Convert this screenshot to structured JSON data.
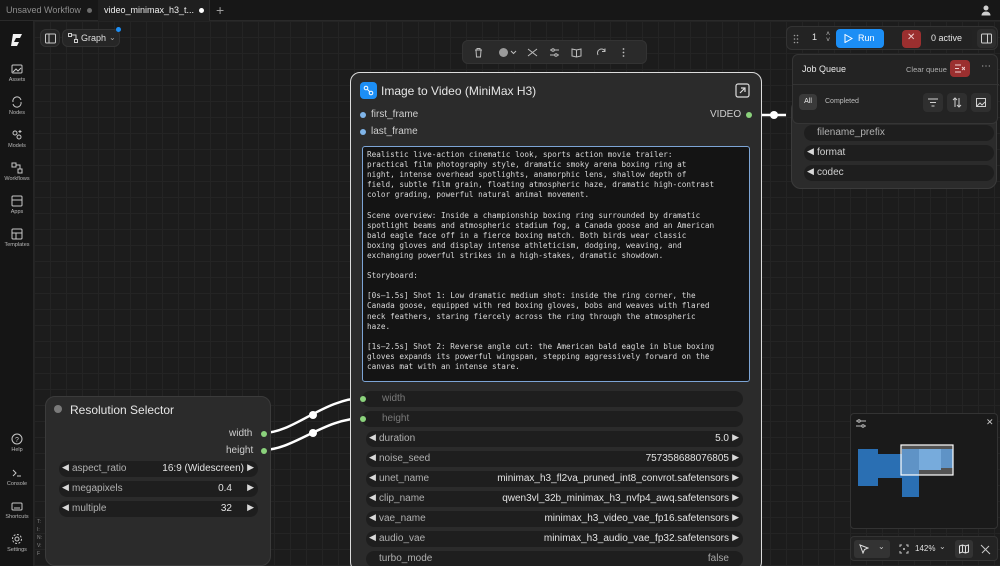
{
  "tabs": [
    {
      "label": "Unsaved Workflow",
      "active": false
    },
    {
      "label": "video_minimax_h3_t...",
      "active": true
    }
  ],
  "sidebar": {
    "items": [
      {
        "label": "Assets",
        "icon": "image-icon"
      },
      {
        "label": "Nodes",
        "icon": "nodes-icon"
      },
      {
        "label": "Models",
        "icon": "models-icon"
      },
      {
        "label": "Workflows",
        "icon": "workflows-icon"
      },
      {
        "label": "Apps",
        "icon": "apps-icon"
      },
      {
        "label": "Templates",
        "icon": "templates-icon"
      }
    ],
    "bottom_items": [
      {
        "label": "Help",
        "icon": "help-icon"
      },
      {
        "label": "Console",
        "icon": "console-icon"
      },
      {
        "label": "Shortcuts",
        "icon": "keyboard-icon"
      },
      {
        "label": "Settings",
        "icon": "settings-icon"
      }
    ]
  },
  "toolbar": {
    "graph_label": "Graph"
  },
  "run_bar": {
    "count": "1",
    "run_label": "Run",
    "active_label": "0 active"
  },
  "job_queue": {
    "title": "Job Queue",
    "clear_label": "Clear queue",
    "filter_all": "All",
    "filter_completed": "Completed"
  },
  "save_node": {
    "widgets": [
      "filename_prefix",
      "format",
      "codec"
    ]
  },
  "video_node": {
    "title": "Image to Video (MiniMax H3)",
    "inputs": [
      "first_frame",
      "last_frame"
    ],
    "output": "VIDEO",
    "prompt": "Realistic live-action cinematic look, sports action movie trailer:\npractical film photography style, dramatic smoky arena boxing ring at\nnight, intense overhead spotlights, anamorphic lens, shallow depth of\nfield, subtle film grain, floating atmospheric haze, dramatic high-contrast\ncolor grading, powerful natural animal movement.\n\nScene overview: Inside a championship boxing ring surrounded by dramatic\nspotlight beams and atmospheric stadium fog, a Canada goose and an American\nbald eagle face off in a fierce boxing match. Both birds wear classic\nboxing gloves and display intense athleticism, dodging, weaving, and\nexchanging powerful strikes in a high-stakes, dramatic showdown.\n\nStoryboard:\n\n[0s–1.5s] Shot 1: Low dramatic medium shot: inside the ring corner, the\nCanada goose, equipped with red boxing gloves, bobs and weaves with flared\nneck feathers, staring fiercely across the ring through the atmospheric\nhaze.\n\n[1s–2.5s] Shot 2: Reverse angle cut: the American bald eagle in blue boxing\ngloves expands its powerful wingspan, stepping aggressively forward on the\ncanvas mat with an intense stare.",
    "linked_inputs": [
      "width",
      "height"
    ],
    "widgets": [
      {
        "label": "duration",
        "value": "5.0"
      },
      {
        "label": "noise_seed",
        "value": "757358688076805"
      },
      {
        "label": "unet_name",
        "value": "minimax_h3_fl2va_pruned_int8_convrot.safetensors"
      },
      {
        "label": "clip_name",
        "value": "qwen3vl_32b_minimax_h3_nvfp4_awq.safetensors"
      },
      {
        "label": "vae_name",
        "value": "minimax_h3_video_vae_fp16.safetensors"
      },
      {
        "label": "audio_vae",
        "value": "minimax_h3_audio_vae_fp32.safetensors"
      },
      {
        "label": "turbo_mode",
        "value": "false"
      }
    ]
  },
  "resolution_node": {
    "title": "Resolution Selector",
    "outputs": [
      "width",
      "height"
    ],
    "widgets": [
      {
        "label": "aspect_ratio",
        "value": "16:9 (Widescreen)"
      },
      {
        "label": "megapixels",
        "value": "0.4"
      },
      {
        "label": "multiple",
        "value": "32"
      }
    ]
  },
  "minimap": {
    "zoom": "142%"
  },
  "colors": {
    "accent": "#1c8ef5",
    "link": "#ffffff",
    "slot_green": "#8bd27c",
    "slot_blue": "#7fb4e8",
    "cancel": "#9b2f2f"
  }
}
